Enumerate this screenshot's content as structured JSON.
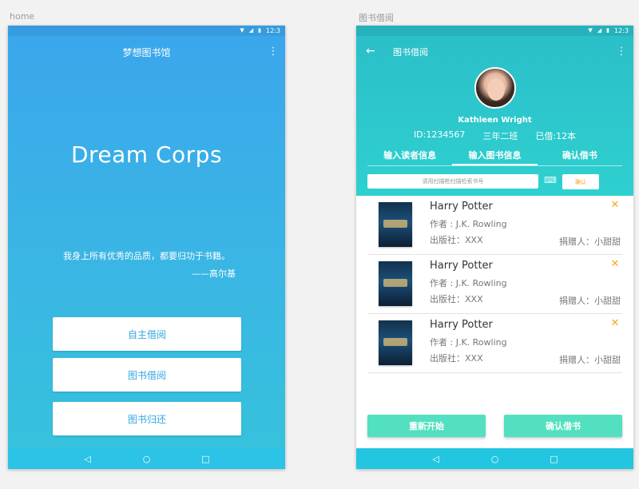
{
  "labels": {
    "home": "home",
    "borrow": "图书借阅"
  },
  "status": {
    "time": "12:3"
  },
  "home": {
    "title": "梦想图书馆",
    "brand": "Dream Corps",
    "quote": "我身上所有优秀的品质，都要归功于书籍。",
    "author": "——高尔基",
    "buttons": [
      "自主借阅",
      "图书借阅",
      "图书归还"
    ]
  },
  "borrow": {
    "title": "图书借阅",
    "user": {
      "name": "Kathleen Wright",
      "id": "ID:1234567",
      "class": "三年二班",
      "borrowed": "已借:12本"
    },
    "tabs": [
      "输入读者信息",
      "输入图书信息",
      "确认借书"
    ],
    "scan_placeholder": "请用扫描枪扫描检索书号",
    "confirm_label": "确认",
    "books": [
      {
        "title": "Harry Potter",
        "author": "作者 : J.K. Rowling",
        "publisher": "出版社：XXX",
        "donor": "捐赠人：小甜甜"
      },
      {
        "title": "Harry Potter",
        "author": "作者 : J.K. Rowling",
        "publisher": "出版社：XXX",
        "donor": "捐赠人：小甜甜"
      },
      {
        "title": "Harry Potter",
        "author": "作者 : J.K. Rowling",
        "publisher": "出版社：XXX",
        "donor": "捐赠人：小甜甜"
      }
    ],
    "restart_label": "重新开始",
    "confirm_borrow_label": "确认借书"
  },
  "icons": {
    "wifi": "wifi-icon",
    "signal": "signal-icon",
    "battery": "battery-icon",
    "menu": "more-vert-icon",
    "back": "arrow-back-icon",
    "keyboard": "keyboard-icon",
    "remove": "close-icon",
    "nav_back": "nav-back-icon",
    "nav_home": "nav-home-icon",
    "nav_recent": "nav-recent-icon"
  },
  "colors": {
    "accent_orange": "#f5a623",
    "mint": "#52e0c0",
    "teal": "#2ecfd0",
    "home_blue": "#3aa6ec"
  }
}
